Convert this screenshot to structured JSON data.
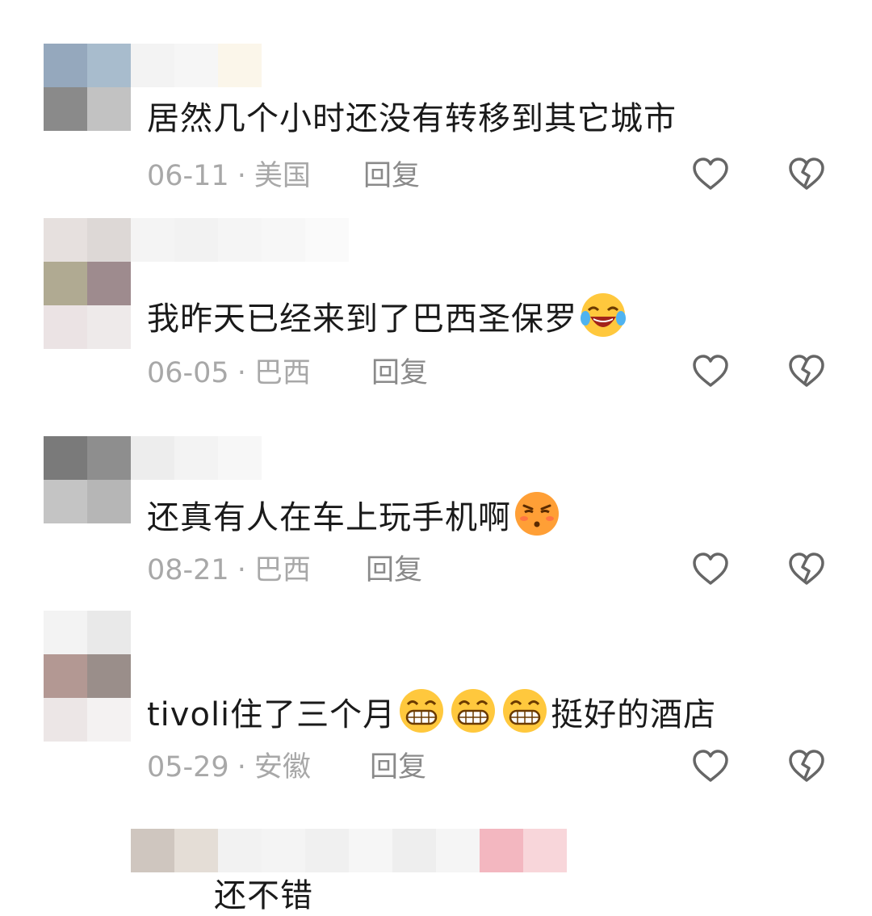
{
  "comments": [
    {
      "text": "居然几个小时还没有转移到其它城市",
      "date": "06-11",
      "location": "美国",
      "reply_label": "回复"
    },
    {
      "text": "我昨天已经来到了巴西圣保罗",
      "emoji": [
        "laugh-cry-emoji"
      ],
      "date": "06-05",
      "location": "巴西",
      "reply_label": "回复"
    },
    {
      "text": "还真有人在车上玩手机啊",
      "emoji": [
        "skeptical-emoji"
      ],
      "date": "08-21",
      "location": "巴西",
      "reply_label": "回复"
    },
    {
      "text_before": "tivoli住了三个月",
      "emoji": [
        "grin-emoji",
        "grin-emoji",
        "grin-emoji"
      ],
      "text_after": "挺好的酒店",
      "date": "05-29",
      "location": "安徽",
      "reply_label": "回复"
    },
    {
      "text": "还不错"
    }
  ],
  "separator": "·",
  "icons": {
    "like": "heart-outline-icon",
    "dislike": "broken-heart-icon"
  },
  "colors": {
    "text": "#1a1a1a",
    "meta": "#a8a8a8",
    "reply": "#8a8a8a",
    "icon": "#666666"
  }
}
